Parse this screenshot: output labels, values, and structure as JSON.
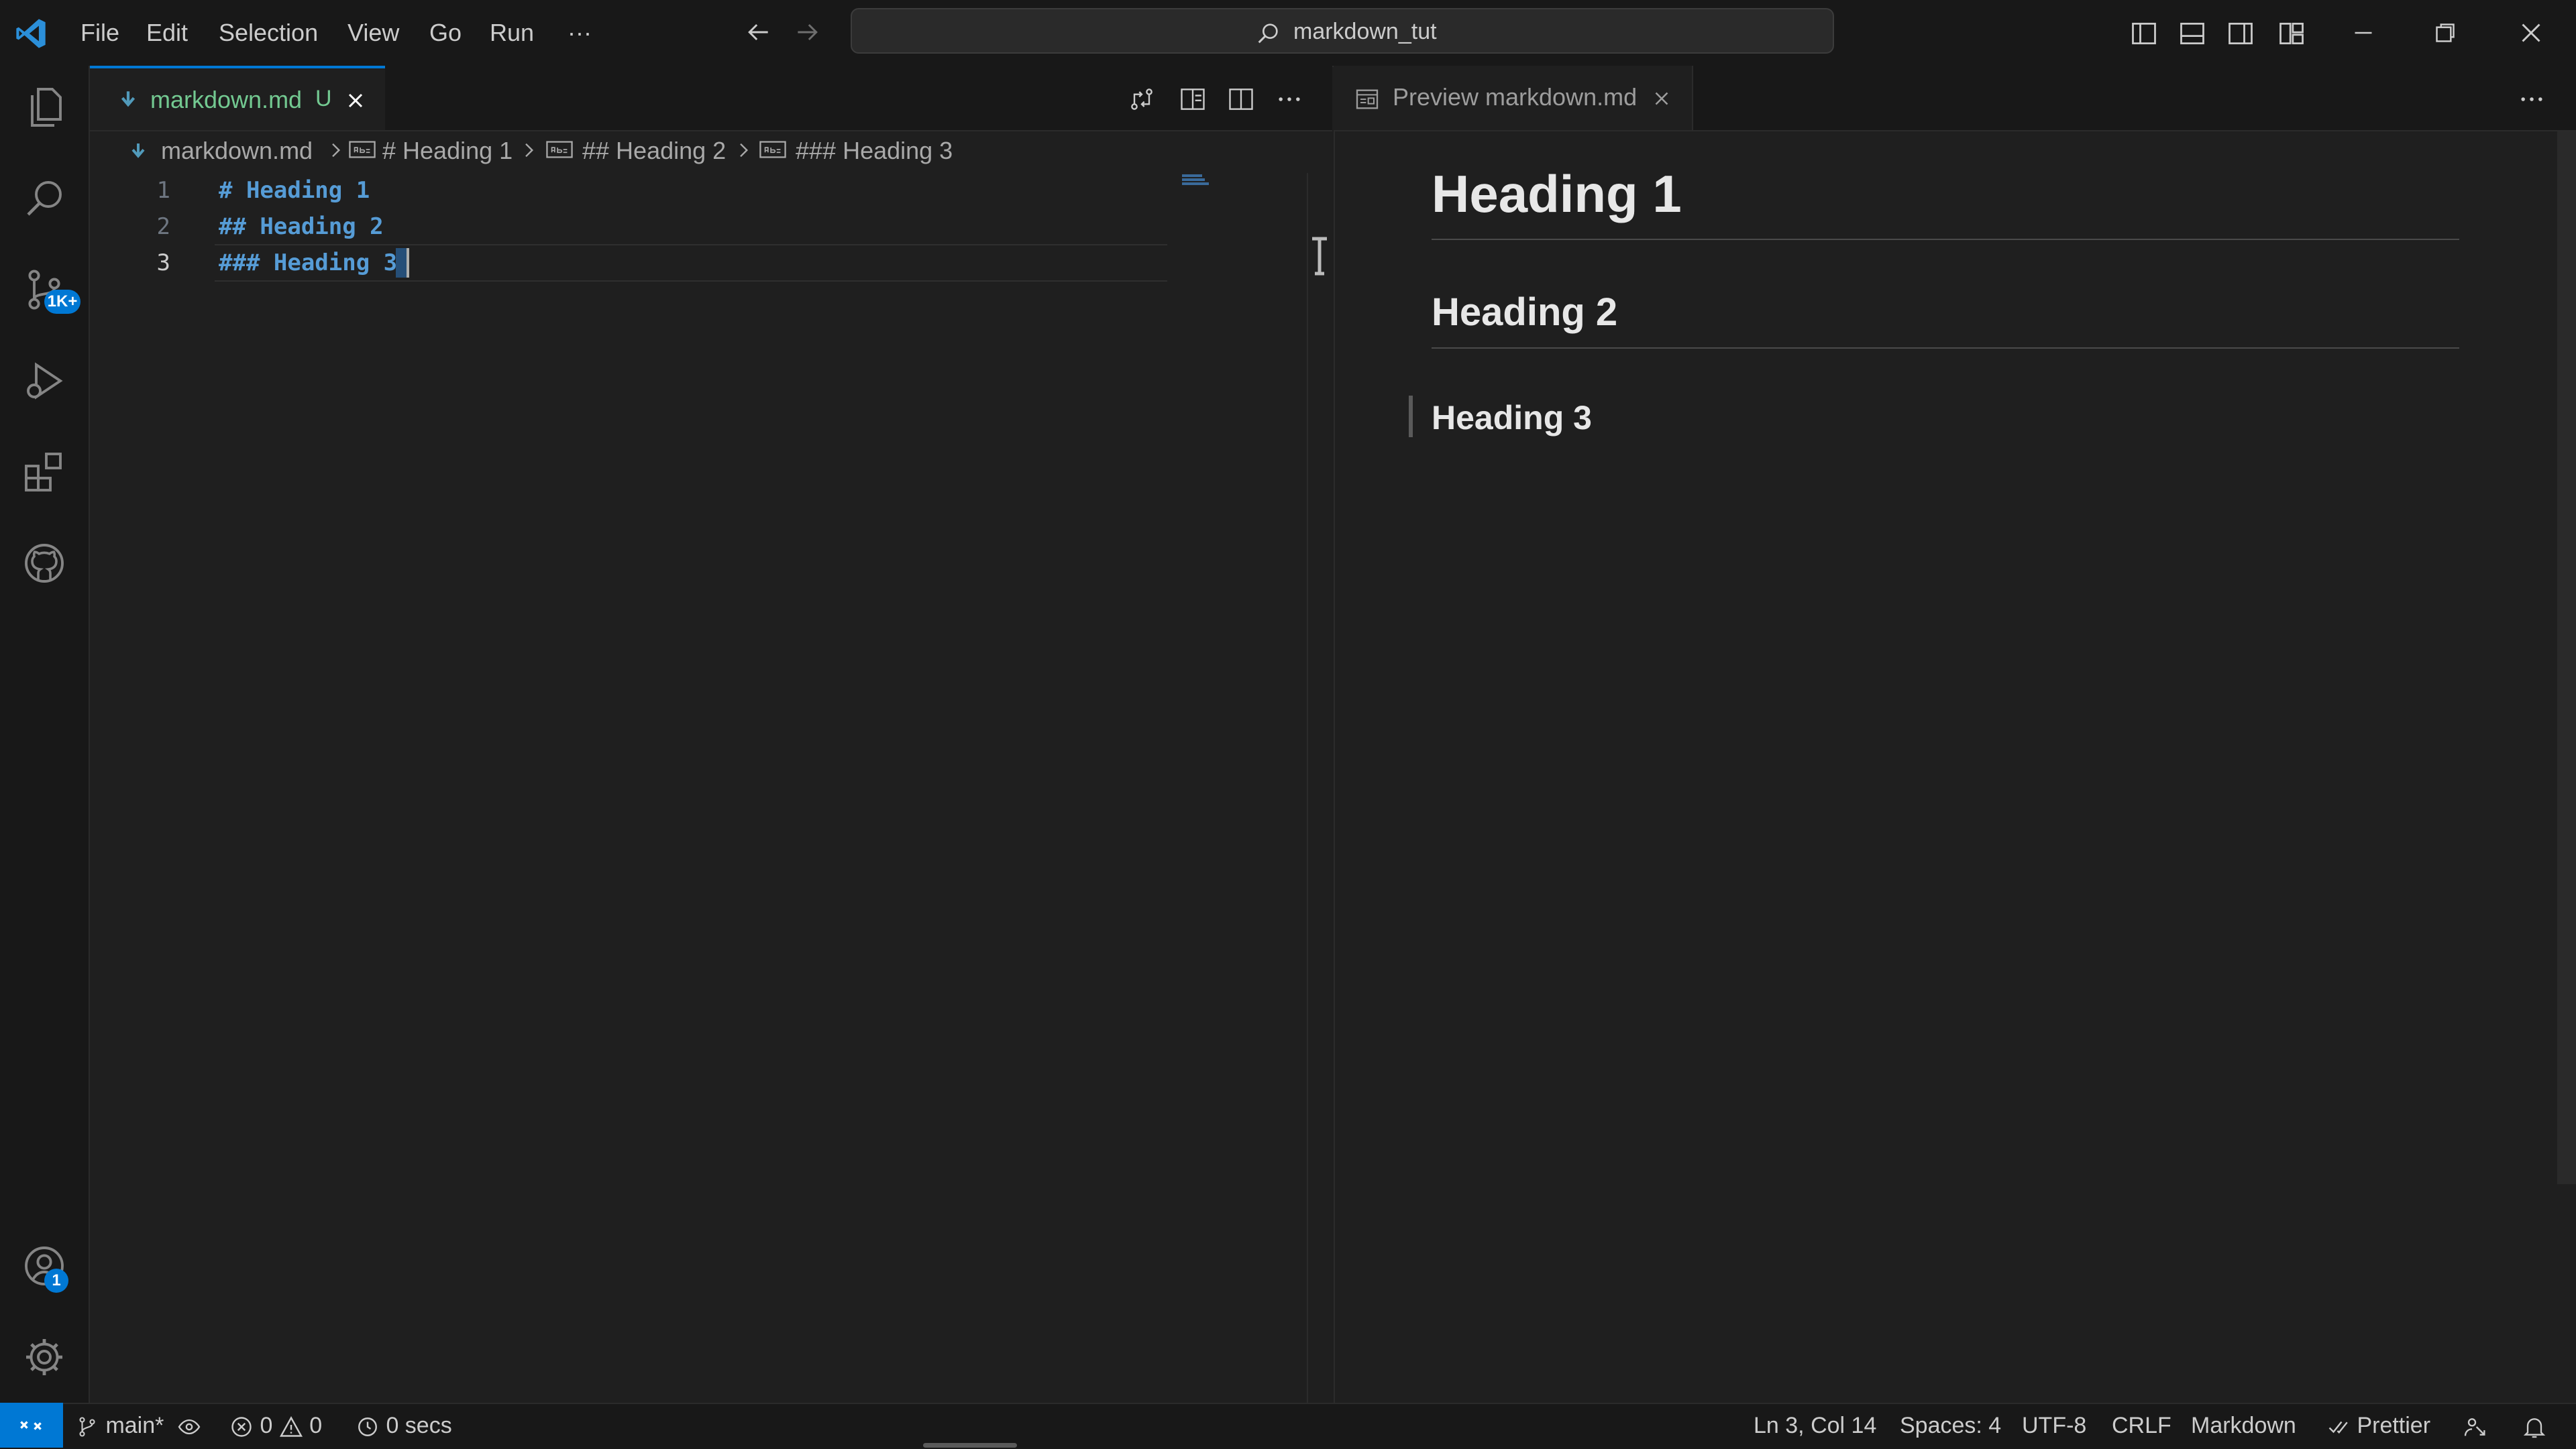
{
  "colors": {
    "accent": "#0078d4",
    "modified": "#73c991",
    "heading_syntax": "#569cd6",
    "background": "#1f1f1f",
    "chrome": "#181818"
  },
  "titlebar": {
    "menu": [
      "File",
      "Edit",
      "Selection",
      "View",
      "Go",
      "Run",
      "···"
    ],
    "command_center": "markdown_tut"
  },
  "activitybar": {
    "source_control_badge": "1K+",
    "accounts_badge": "1"
  },
  "editor": {
    "tab": {
      "label": "markdown.md",
      "status": "U"
    },
    "breadcrumb": [
      "markdown.md",
      "# Heading 1",
      "## Heading 2",
      "### Heading 3"
    ],
    "lines": [
      {
        "num": "1",
        "text": "# Heading 1"
      },
      {
        "num": "2",
        "text": "## Heading 2"
      },
      {
        "num": "3",
        "text": "### Heading 3"
      }
    ]
  },
  "preview": {
    "tab": {
      "label": "Preview markdown.md"
    },
    "h1": "Heading 1",
    "h2": "Heading 2",
    "h3": "Heading 3"
  },
  "statusbar": {
    "branch": "main*",
    "errors": "0",
    "warnings": "0",
    "timer": "0 secs",
    "cursor_pos": "Ln 3, Col 14",
    "spaces": "Spaces: 4",
    "encoding": "UTF-8",
    "eol": "CRLF",
    "language": "Markdown",
    "formatter": "Prettier"
  }
}
